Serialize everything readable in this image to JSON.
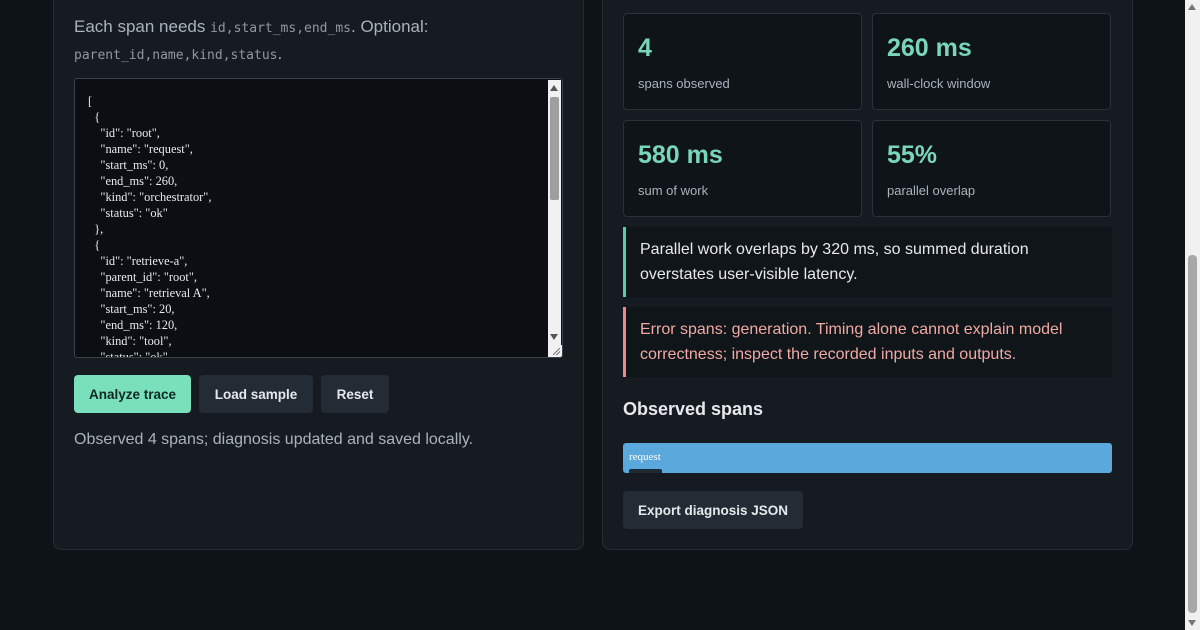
{
  "input_panel": {
    "hint_prefix": "Each span needs ",
    "required_fields": "id,start_ms,end_ms",
    "hint_middle": ". Optional:",
    "optional_fields": "parent_id,name,kind,status",
    "hint_suffix": ".",
    "editor_text": "[\n  {\n    \"id\": \"root\",\n    \"name\": \"request\",\n    \"start_ms\": 0,\n    \"end_ms\": 260,\n    \"kind\": \"orchestrator\",\n    \"status\": \"ok\"\n  },\n  {\n    \"id\": \"retrieve-a\",\n    \"parent_id\": \"root\",\n    \"name\": \"retrieval A\",\n    \"start_ms\": 20,\n    \"end_ms\": 120,\n    \"kind\": \"tool\",\n    \"status\": \"ok\",",
    "buttons": {
      "analyze": "Analyze trace",
      "load_sample": "Load sample",
      "reset": "Reset"
    },
    "status": "Observed 4 spans; diagnosis updated and saved locally."
  },
  "results_panel": {
    "stats": [
      {
        "value": "4",
        "label": "spans observed"
      },
      {
        "value": "260 ms",
        "label": "wall-clock window"
      },
      {
        "value": "580 ms",
        "label": "sum of work"
      },
      {
        "value": "55%",
        "label": "parallel overlap"
      }
    ],
    "info_callout": "Parallel work overlaps by 320 ms, so summed duration overstates user-visible latency.",
    "error_callout": "Error spans: generation. Timing alone cannot explain model correctness; inspect the recorded inputs and outputs.",
    "section_title": "Observed spans",
    "timeline": {
      "span_label": "request"
    },
    "export_label": "Export diagnosis JSON"
  },
  "colors": {
    "background": "#0e1318",
    "accent": "#79e0bb",
    "info_border": "#5ec7a5",
    "error_text": "#f0a9a4",
    "span_bar": "#5aa8dc"
  }
}
